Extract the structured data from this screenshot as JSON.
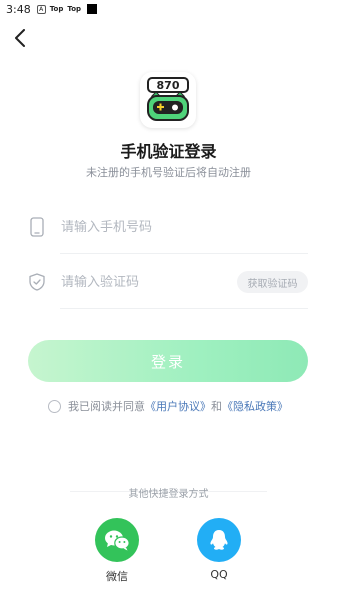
{
  "status_bar": {
    "time": "3:48",
    "app_icon_letter": "A",
    "notif1": "Top",
    "notif2": "Top"
  },
  "header": {
    "back_icon": "chevron-left-icon"
  },
  "logo": {
    "text": "870",
    "icon": "game-controller-mascot-icon"
  },
  "title": "手机验证登录",
  "subtitle": "未注册的手机号验证后将自动注册",
  "form": {
    "phone_placeholder": "请输入手机号码",
    "code_placeholder": "请输入验证码",
    "get_code_label": "获取验证码"
  },
  "login_label": "登录",
  "agreement": {
    "prefix": "我已阅读并同意",
    "user_agreement": "《用户协议》",
    "and": "和",
    "privacy_policy": "《隐私政策》"
  },
  "other_login": {
    "label": "其他快捷登录方式",
    "options": [
      {
        "label": "微信",
        "icon": "wechat-icon",
        "color": "#33c35a"
      },
      {
        "label": "QQ",
        "icon": "qq-icon",
        "color": "#22aef5"
      }
    ]
  },
  "colors": {
    "accent_green": "#9ff0c0",
    "link_blue": "#4a78b8"
  }
}
